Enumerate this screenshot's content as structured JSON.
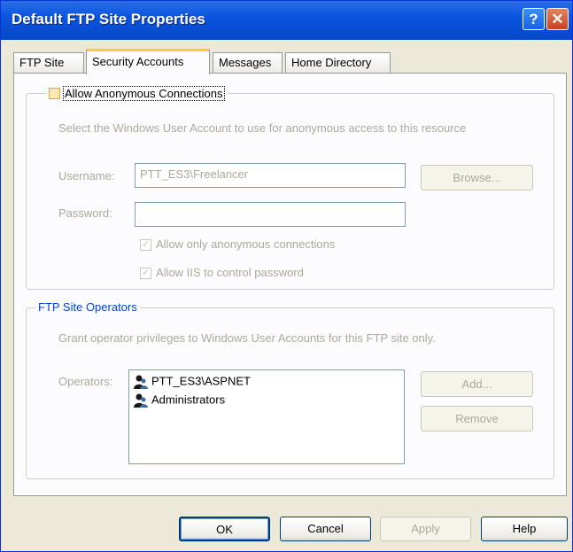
{
  "window": {
    "title": "Default FTP Site Properties",
    "help_glyph": "?",
    "close_glyph": "✕"
  },
  "tabs": [
    {
      "label": "FTP Site"
    },
    {
      "label": "Security Accounts"
    },
    {
      "label": "Messages"
    },
    {
      "label": "Home Directory"
    }
  ],
  "anonymous": {
    "checkbox_label": "Allow Anonymous Connections",
    "description": "Select the Windows User Account to use for anonymous access to this resource",
    "username_label": "Username:",
    "username_value": "PTT_ES3\\Freelancer",
    "password_label": "Password:",
    "password_value": "",
    "browse_label": "Browse...",
    "only_anonymous_label": "Allow only anonymous connections",
    "iis_password_label": "Allow IIS to control password",
    "check_glyph": "✓"
  },
  "operators": {
    "group_label": "FTP Site Operators",
    "description": "Grant operator privileges to Windows User Accounts for this FTP site only.",
    "operators_label": "Operators:",
    "items": [
      "PTT_ES3\\ASPNET",
      "Administrators"
    ],
    "add_label": "Add...",
    "remove_label": "Remove"
  },
  "footer": {
    "ok_label": "OK",
    "cancel_label": "Cancel",
    "apply_label": "Apply",
    "help_label": "Help"
  }
}
